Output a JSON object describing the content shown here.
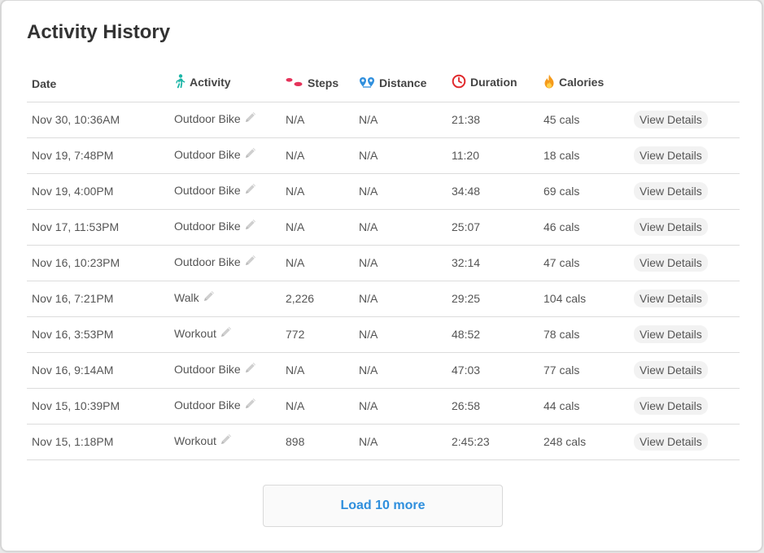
{
  "title": "Activity History",
  "columns": {
    "date": "Date",
    "activity": "Activity",
    "steps": "Steps",
    "distance": "Distance",
    "duration": "Duration",
    "calories": "Calories"
  },
  "icons": {
    "activity": "walking-person-icon",
    "steps": "footprints-icon",
    "distance": "route-pins-icon",
    "duration": "stopwatch-icon",
    "calories": "flame-icon",
    "edit": "pencil-icon"
  },
  "colors": {
    "activity_icon": "#1bb5a6",
    "steps_icon": "#e5335a",
    "distance_icon": "#2f8fdd",
    "duration_icon": "#e0292c",
    "calories_icon": "#f59a1b",
    "link": "#2f8fdd"
  },
  "rows": [
    {
      "date": "Nov 30, 10:36AM",
      "activity": "Outdoor Bike",
      "steps": "N/A",
      "distance": "N/A",
      "duration": "21:38",
      "calories": "45 cals",
      "action": "View Details"
    },
    {
      "date": "Nov 19, 7:48PM",
      "activity": "Outdoor Bike",
      "steps": "N/A",
      "distance": "N/A",
      "duration": "11:20",
      "calories": "18 cals",
      "action": "View Details"
    },
    {
      "date": "Nov 19, 4:00PM",
      "activity": "Outdoor Bike",
      "steps": "N/A",
      "distance": "N/A",
      "duration": "34:48",
      "calories": "69 cals",
      "action": "View Details"
    },
    {
      "date": "Nov 17, 11:53PM",
      "activity": "Outdoor Bike",
      "steps": "N/A",
      "distance": "N/A",
      "duration": "25:07",
      "calories": "46 cals",
      "action": "View Details"
    },
    {
      "date": "Nov 16, 10:23PM",
      "activity": "Outdoor Bike",
      "steps": "N/A",
      "distance": "N/A",
      "duration": "32:14",
      "calories": "47 cals",
      "action": "View Details"
    },
    {
      "date": "Nov 16, 7:21PM",
      "activity": "Walk",
      "steps": "2,226",
      "distance": "N/A",
      "duration": "29:25",
      "calories": "104 cals",
      "action": "View Details"
    },
    {
      "date": "Nov 16, 3:53PM",
      "activity": "Workout",
      "steps": "772",
      "distance": "N/A",
      "duration": "48:52",
      "calories": "78 cals",
      "action": "View Details"
    },
    {
      "date": "Nov 16, 9:14AM",
      "activity": "Outdoor Bike",
      "steps": "N/A",
      "distance": "N/A",
      "duration": "47:03",
      "calories": "77 cals",
      "action": "View Details"
    },
    {
      "date": "Nov 15, 10:39PM",
      "activity": "Outdoor Bike",
      "steps": "N/A",
      "distance": "N/A",
      "duration": "26:58",
      "calories": "44 cals",
      "action": "View Details"
    },
    {
      "date": "Nov 15, 1:18PM",
      "activity": "Workout",
      "steps": "898",
      "distance": "N/A",
      "duration": "2:45:23",
      "calories": "248 cals",
      "action": "View Details"
    }
  ],
  "load_more_label": "Load 10 more"
}
